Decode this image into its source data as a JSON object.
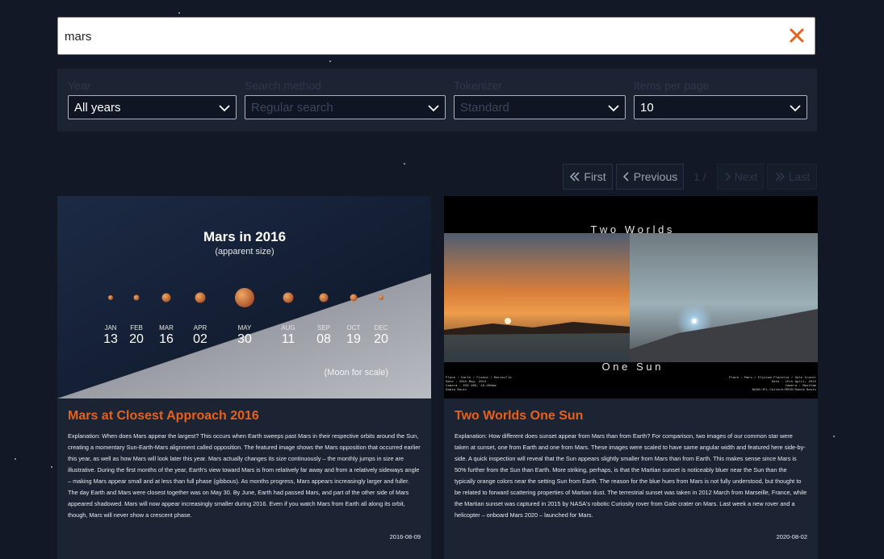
{
  "search": {
    "value": "mars",
    "placeholder": ""
  },
  "filters": [
    {
      "label": "Year",
      "value": "All years",
      "disabled": false
    },
    {
      "label": "Search method",
      "value": "Regular search",
      "disabled": true
    },
    {
      "label": "Tokenizer",
      "value": "Standard",
      "disabled": true
    },
    {
      "label": "Items per page",
      "value": "10",
      "disabled": false
    }
  ],
  "pagination": {
    "first_label": "First",
    "previous_label": "Previous",
    "page_info": "1 /",
    "next_label": "Next",
    "last_label": "Last"
  },
  "cards": [
    {
      "title": "Mars at Closest Approach 2016",
      "explanation": "Explanation: When does Mars appear the largest? This occurs when Earth sweeps past Mars in their respective orbits around the Sun, creating a momentary Sun-Earth-Mars alignment called opposition. The featured image shows the Mars opposition that occurred earlier this year, as well as how Mars will look later this year. Mars actually changes its size continuously – the monthly jumps in size are illustrative. During the first months of the year, Earth's view toward Mars is from relatively far away and from a relatively sideways angle – making Mars appear small and at less than full phase (gibbous). As months progress, Mars appears increasingly larger and fuller. The day Earth and Mars were closest together was on May 30. By June, Earth had passed Mars, and part of the other side of Mars appeared shadowed. Mars will now appear increasingly smaller during 2016. Even if you watch Mars from Earth all along its orbit, though, Mars will never show a crescent phase.",
      "date": "2016-08-09",
      "image": {
        "title": "Mars in 2016",
        "subtitle": "(apparent size)",
        "caption": "(Moon for scale)",
        "months": [
          {
            "month": "JAN",
            "day": "13",
            "size": 6
          },
          {
            "month": "FEB",
            "day": "20",
            "size": 7
          },
          {
            "month": "MAR",
            "day": "16",
            "size": 11
          },
          {
            "month": "APR",
            "day": "02",
            "size": 13
          },
          {
            "month": "MAY",
            "day": "30",
            "size": 24
          },
          {
            "month": "AUG",
            "day": "11",
            "size": 13
          },
          {
            "month": "SEP",
            "day": "08",
            "size": 11
          },
          {
            "month": "OCT",
            "day": "19",
            "size": 9
          },
          {
            "month": "DEC",
            "day": "20",
            "size": 6
          }
        ]
      }
    },
    {
      "title": "Two Worlds One Sun",
      "explanation": "Explanation: How different does sunset appear from Mars than from Earth? For comparison, two images of our common star were taken at sunset, one from Earth and one from Mars. These images were scaled to have same angular width and featured here side-by-side. A quick inspection will reveal that the Sun appears slightly smaller from Mars than from Earth. This makes sense since Mars is 50% further from the Sun than Earth. More striking, perhaps, is that the Martian sunset is noticeably bluer near the Sun than the typically orange colors near the setting Sun from Earth. The reason for the blue hues from Mars is not fully understood, but thought to be related to forward scattering properties of Martian dust. The terrestrial sunset was taken in 2012 March from Marseille, France, while the Martian sunset was captured in 2015 by NASA's robotic Curiosity rover from Gale crater on Mars. Last week a new rover and a helicopter – onboard Mars 2020 – launched for Mars.",
      "date": "2020-08-02",
      "image": {
        "top_text": "T w o   W o r l d s",
        "bottom_text": "O n e   S u n",
        "left_credit_1": "Place : Earth / France / Marseille",
        "left_credit_2": "Date : 28th May, 2012",
        "left_credit_3": "Camera : EOS 60D, 18-200mm",
        "left_credit_4": "Damia Bouic",
        "right_credit_1": "Place : Mars / Elysium Planitia / Gale Crater",
        "right_credit_2": "Date : 15th April, 2015",
        "right_credit_3": "Camera : MastCam",
        "right_credit_4": "NASA/JPL-Caltech/MSSS/Damia Bouic"
      }
    }
  ],
  "colors": {
    "accent": "#e8611a",
    "background": "#121826",
    "panel": "#1c2433"
  }
}
